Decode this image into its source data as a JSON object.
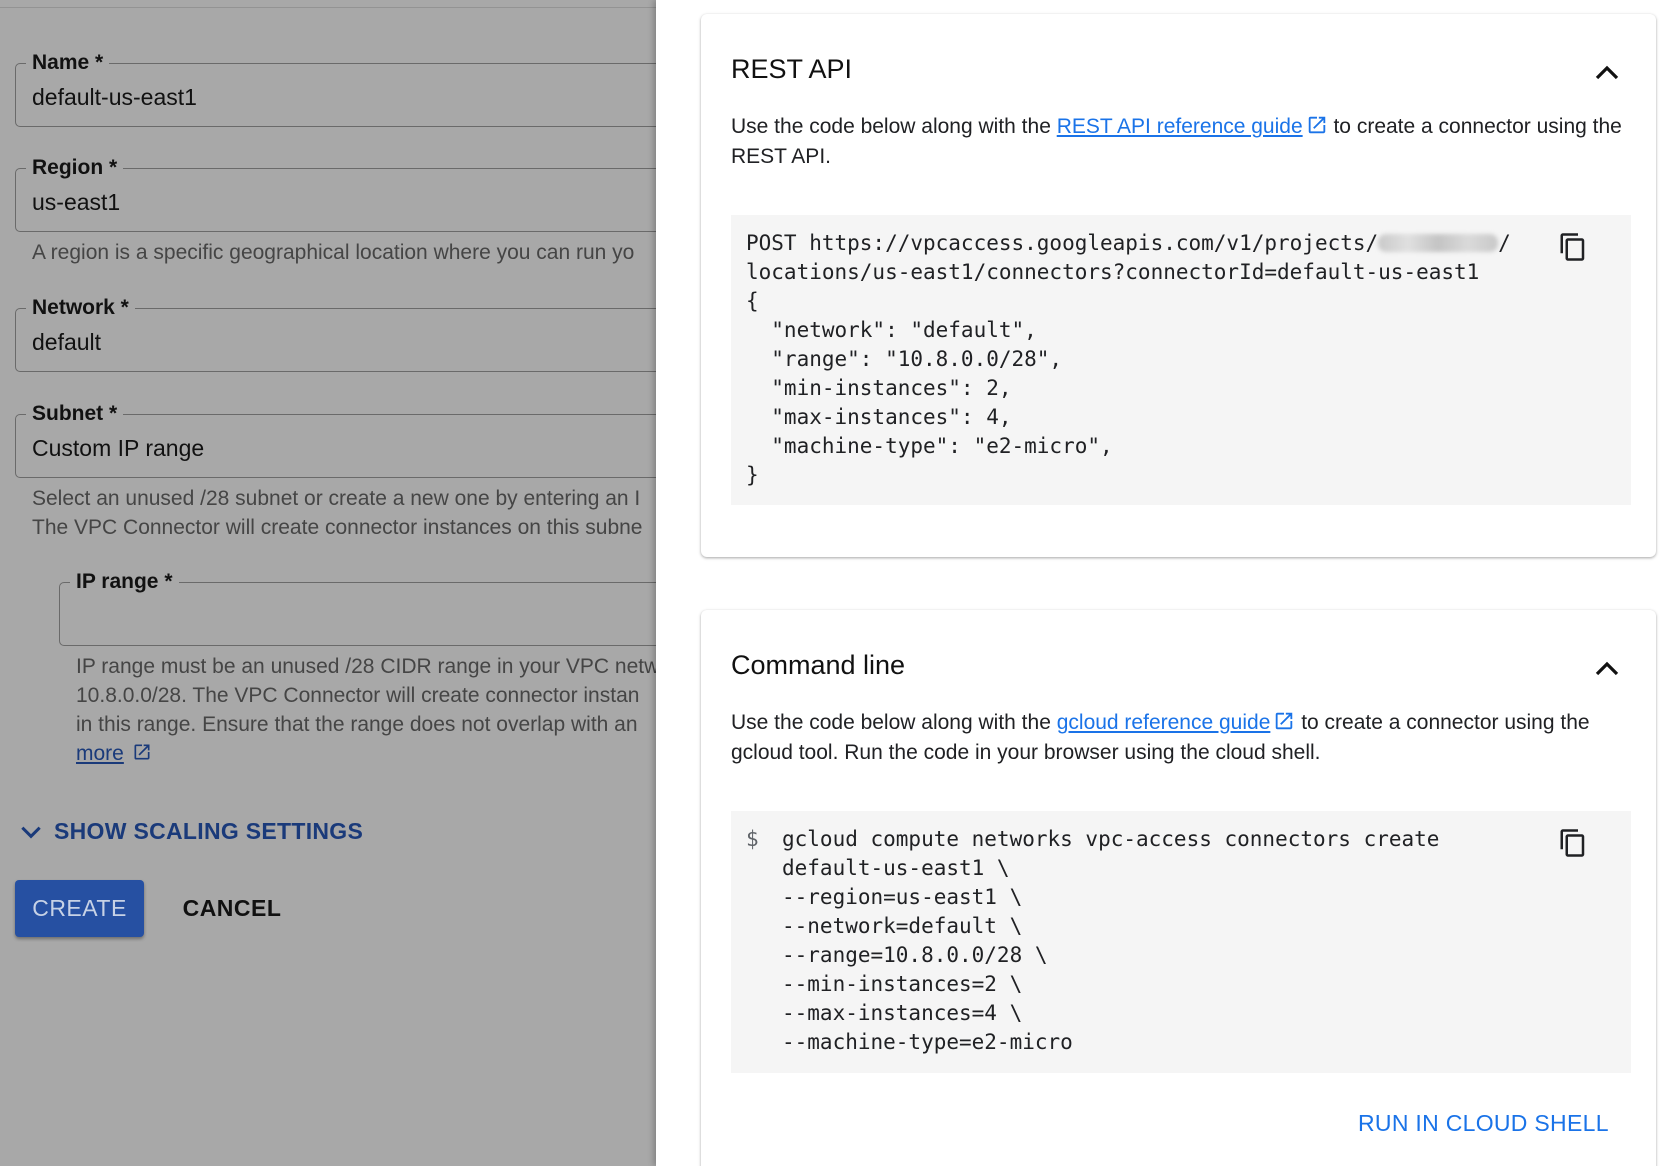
{
  "form": {
    "name": {
      "label": "Name *",
      "value": "default-us-east1"
    },
    "region": {
      "label": "Region *",
      "value": "us-east1",
      "helper": "A region is a specific geographical location where you can run yo"
    },
    "network": {
      "label": "Network *",
      "value": "default"
    },
    "subnet": {
      "label": "Subnet *",
      "value": "Custom IP range",
      "helper_line1": "Select an unused /28 subnet or create a new one by entering an I",
      "helper_line2": "The VPC Connector will create connector instances on this subne"
    },
    "ip_range": {
      "label": "IP range *",
      "value": "",
      "helper_line1": "IP range must be an unused /28 CIDR range in your VPC netw",
      "helper_line2": "10.8.0.0/28. The VPC Connector will create connector instan",
      "helper_line3": "in this range. Ensure that the range does not overlap with an",
      "learn_more": "more"
    },
    "show_scaling": "SHOW SCALING SETTINGS",
    "create": "CREATE",
    "cancel": "CANCEL"
  },
  "rest": {
    "title": "REST API",
    "desc_pre": "Use the code below along with the ",
    "link": "REST API reference guide",
    "desc_post": " to create a connector using the REST API.",
    "code_line1_pre": "POST https://vpcaccess.googleapis.com/v1/projects/",
    "code_line1_post": "/",
    "code_lines": [
      "locations/us-east1/connectors?connectorId=default-us-east1",
      "{",
      "  \"network\": \"default\",",
      "  \"range\": \"10.8.0.0/28\",",
      "  \"min-instances\": 2,",
      "  \"max-instances\": 4,",
      "  \"machine-type\": \"e2-micro\",",
      "}"
    ]
  },
  "cli": {
    "title": "Command line",
    "desc_pre": "Use the code below along with the ",
    "link": "gcloud reference guide",
    "desc_post": " to create a connector using the gcloud tool. Run the code in your browser using the cloud shell.",
    "prompt": "$",
    "code_lines": [
      "gcloud compute networks vpc-access connectors create",
      "default-us-east1 \\",
      "--region=us-east1 \\",
      "--network=default \\",
      "--range=10.8.0.0/28 \\",
      "--min-instances=2 \\",
      "--max-instances=4 \\",
      "--machine-type=e2-micro"
    ],
    "run_button": "RUN IN CLOUD SHELL"
  }
}
